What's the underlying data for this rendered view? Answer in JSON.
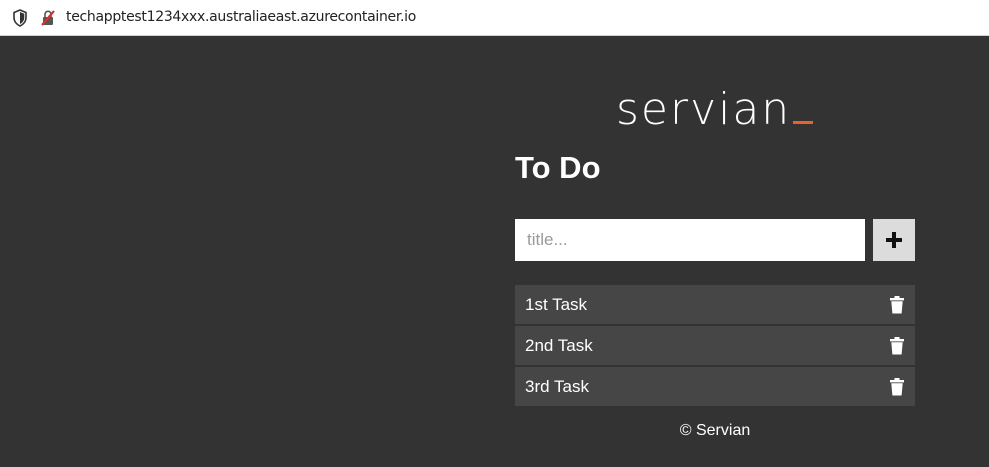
{
  "browser": {
    "url": "techapptest1234xxx.australiaeast.azurecontainer.io",
    "icons": [
      "shield-icon",
      "insecure-lock-icon"
    ]
  },
  "brand": {
    "logo_text": "servian",
    "accent_color": "#e8622c"
  },
  "page": {
    "title": "To Do",
    "background": "#333333"
  },
  "new_task": {
    "placeholder": "title...",
    "value": "",
    "add_icon": "plus-icon"
  },
  "tasks": [
    {
      "label": "1st Task",
      "icon": "trash-icon"
    },
    {
      "label": "2nd Task",
      "icon": "trash-icon"
    },
    {
      "label": "3rd Task",
      "icon": "trash-icon"
    }
  ],
  "footer": {
    "text": "© Servian"
  }
}
